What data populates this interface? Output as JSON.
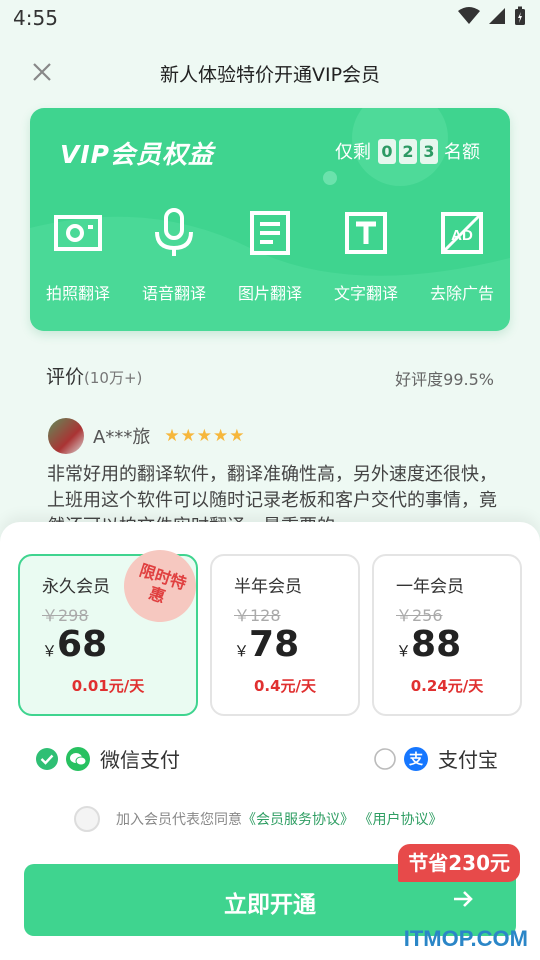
{
  "status": {
    "time": "4:55"
  },
  "header": {
    "title": "新人体验特价开通VIP会员"
  },
  "vip_card": {
    "title": "VIP会员权益",
    "quota_prefix": "仅剩",
    "quota_digits": [
      "0",
      "2",
      "3"
    ],
    "quota_suffix": "名额",
    "benefits": [
      {
        "label": "拍照翻译",
        "icon": "camera-icon"
      },
      {
        "label": "语音翻译",
        "icon": "microphone-icon"
      },
      {
        "label": "图片翻译",
        "icon": "document-icon"
      },
      {
        "label": "文字翻译",
        "icon": "text-icon"
      },
      {
        "label": "去除广告",
        "icon": "no-ad-icon"
      }
    ]
  },
  "reviews": {
    "title": "评价",
    "count": "(10万+)",
    "rating": "好评度99.5%",
    "items": [
      {
        "name": "A***旅",
        "stars": "★★★★★",
        "text": "非常好用的翻译软件，翻译准确性高，另外速度还很快，上班用这个软件可以随时记录老板和客户交代的事情，竟然还可以拍文件实时翻译，最重要的"
      }
    ]
  },
  "plans": [
    {
      "name": "永久会员",
      "old_price": "￥298",
      "currency": "￥",
      "price": "68",
      "daily": "0.01元/天",
      "badge": "限时特惠"
    },
    {
      "name": "半年会员",
      "old_price": "￥128",
      "currency": "￥",
      "price": "78",
      "daily": "0.4元/天"
    },
    {
      "name": "一年会员",
      "old_price": "￥256",
      "currency": "￥",
      "price": "88",
      "daily": "0.24元/天"
    }
  ],
  "payment": {
    "wechat": {
      "label": "微信支付",
      "selected": true
    },
    "alipay": {
      "label": "支付宝",
      "selected": false
    }
  },
  "agreement": {
    "text": "加入会员代表您同意",
    "link1": "《会员服务协议》",
    "link2": "《用户协议》"
  },
  "cta": {
    "label": "立即开通",
    "badge": "节省230元"
  },
  "watermark": "ITMOP.COM",
  "colors": {
    "accent": "#3fd48f",
    "price_red": "#e03030",
    "badge_red": "#e74a4a"
  }
}
